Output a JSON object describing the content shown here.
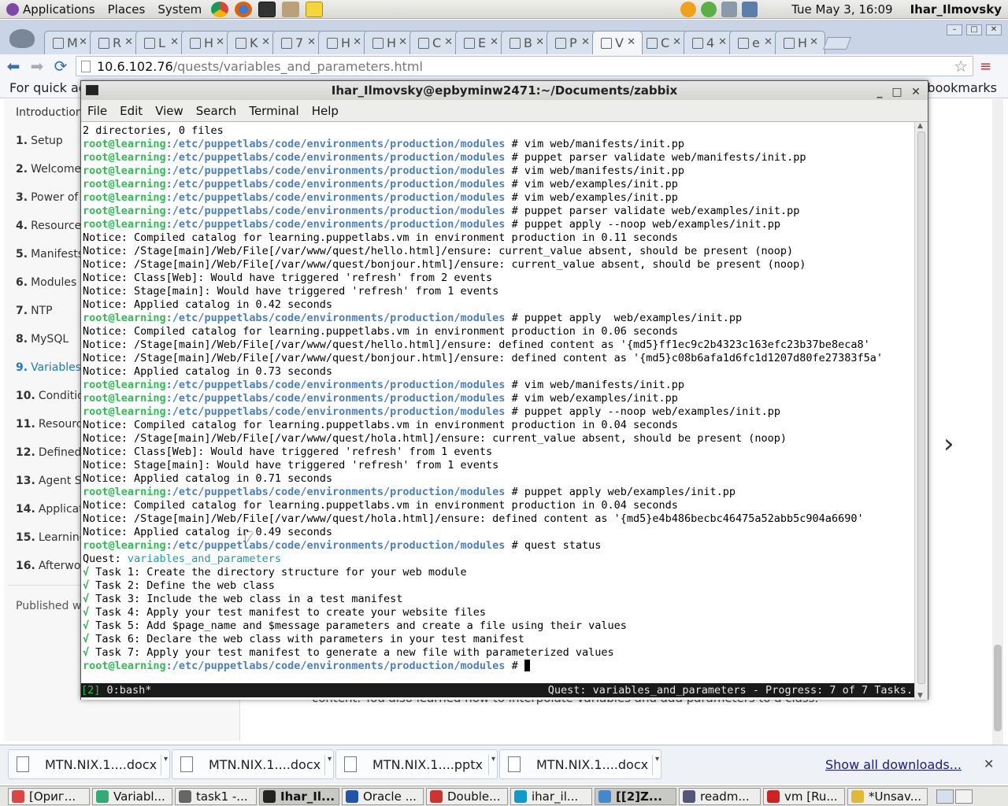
{
  "panel": {
    "menus": [
      "Applications",
      "Places",
      "System"
    ],
    "launchers": [
      "chrome-icon",
      "firefox-icon",
      "terminal-icon",
      "file-manager-icon",
      "notes-icon"
    ],
    "tray_icons": [
      "weather-icon",
      "chat-icon",
      "volume-icon",
      "network-icon"
    ],
    "clock": "Tue May  3, 16:09",
    "user": "Ihar_Ilmovsky"
  },
  "chrome": {
    "tabs": [
      {
        "label": "M"
      },
      {
        "label": "R"
      },
      {
        "label": "L"
      },
      {
        "label": "H"
      },
      {
        "label": "K"
      },
      {
        "label": "7"
      },
      {
        "label": "H"
      },
      {
        "label": "H"
      },
      {
        "label": "C"
      },
      {
        "label": "E"
      },
      {
        "label": "B"
      },
      {
        "label": "P"
      },
      {
        "label": "V",
        "active": true
      },
      {
        "label": "C"
      },
      {
        "label": "4"
      },
      {
        "label": "e"
      },
      {
        "label": "H"
      }
    ],
    "url_host": "10.6.102.76",
    "url_path": "/quests/variables_and_parameters.html",
    "bookmarks_hint": "For quick ac",
    "other_bookmarks": "bookmarks"
  },
  "sidebar": {
    "intro": "Introduction",
    "items": [
      {
        "num": "1.",
        "label": "Setup"
      },
      {
        "num": "2.",
        "label": "Welcome"
      },
      {
        "num": "3.",
        "label": "Power of P"
      },
      {
        "num": "4.",
        "label": "Resource"
      },
      {
        "num": "5.",
        "label": "Manifests"
      },
      {
        "num": "6.",
        "label": "Modules"
      },
      {
        "num": "7.",
        "label": "NTP"
      },
      {
        "num": "8.",
        "label": "MySQL"
      },
      {
        "num": "9.",
        "label": "Variables",
        "current": true
      },
      {
        "num": "10.",
        "label": "Condition"
      },
      {
        "num": "11.",
        "label": "Resourc"
      },
      {
        "num": "12.",
        "label": "Defined r"
      },
      {
        "num": "13.",
        "label": "Agent Se"
      },
      {
        "num": "14.",
        "label": "Applicati"
      },
      {
        "num": "15.",
        "label": "Learning"
      },
      {
        "num": "16.",
        "label": "Afterwor"
      }
    ],
    "published": "Published wi"
  },
  "page": {
    "partial_text": "content. You also learned how to interpolate variables and add parameters to a class."
  },
  "downloads": {
    "items": [
      {
        "name": "MTN.NIX.1....docx"
      },
      {
        "name": "MTN.NIX.1....docx"
      },
      {
        "name": "MTN.NIX.1....pptx"
      },
      {
        "name": "MTN.NIX.1....docx"
      }
    ],
    "show_all": "Show all downloads...",
    "close": "✕"
  },
  "taskbar": {
    "items": [
      {
        "label": "[Ориг...",
        "icon_color": "#d44"
      },
      {
        "label": "Variabl...",
        "icon_color": "#3a7"
      },
      {
        "label": "task1 -...",
        "icon_color": "#666"
      },
      {
        "label": "Ihar_Il...",
        "icon_color": "#222",
        "active": true
      },
      {
        "label": "Oracle ...",
        "icon_color": "#25a"
      },
      {
        "label": "Double...",
        "icon_color": "#c33"
      },
      {
        "label": "ihar_il...",
        "icon_color": "#19c"
      },
      {
        "label": "[[2]Z...",
        "icon_color": "#48c",
        "active": true
      },
      {
        "label": "readm...",
        "icon_color": "#557"
      },
      {
        "label": "vm [Ru...",
        "icon_color": "#c22"
      },
      {
        "label": "*Unsav...",
        "icon_color": "#db3"
      }
    ]
  },
  "terminal": {
    "title": "Ihar_Ilmovsky@epbyminw2471:~/Documents/zabbix",
    "menus": [
      "File",
      "Edit",
      "View",
      "Search",
      "Terminal",
      "Help"
    ],
    "prompt_user": "root@learning",
    "prompt_path": ":/etc/puppetlabs/code/environments/production/modules",
    "prompt_tail": " # ",
    "quest_label": "Quest: ",
    "quest_name": "variables_and_parameters",
    "check": "√",
    "lines": [
      {
        "t": "out",
        "text": "2 directories, 0 files"
      },
      {
        "t": "cmd",
        "text": "vim web/manifests/init.pp"
      },
      {
        "t": "cmd",
        "text": "puppet parser validate web/manifests/init.pp"
      },
      {
        "t": "cmd",
        "text": "vim web/manifests/init.pp"
      },
      {
        "t": "cmd",
        "text": "vim web/examples/init.pp"
      },
      {
        "t": "cmd",
        "text": "vim web/examples/init.pp"
      },
      {
        "t": "cmd",
        "text": "puppet parser validate web/examples/init.pp"
      },
      {
        "t": "cmd",
        "text": "puppet apply --noop web/examples/init.pp"
      },
      {
        "t": "out",
        "text": "Notice: Compiled catalog for learning.puppetlabs.vm in environment production in 0.11 seconds"
      },
      {
        "t": "out",
        "text": "Notice: /Stage[main]/Web/File[/var/www/quest/hello.html]/ensure: current_value absent, should be present (noop)"
      },
      {
        "t": "out",
        "text": "Notice: /Stage[main]/Web/File[/var/www/quest/bonjour.html]/ensure: current_value absent, should be present (noop)"
      },
      {
        "t": "out",
        "text": "Notice: Class[Web]: Would have triggered 'refresh' from 2 events"
      },
      {
        "t": "out",
        "text": "Notice: Stage[main]: Would have triggered 'refresh' from 1 events"
      },
      {
        "t": "out",
        "text": "Notice: Applied catalog in 0.42 seconds"
      },
      {
        "t": "cmd",
        "text": "puppet apply  web/examples/init.pp"
      },
      {
        "t": "out",
        "text": "Notice: Compiled catalog for learning.puppetlabs.vm in environment production in 0.06 seconds"
      },
      {
        "t": "out",
        "text": "Notice: /Stage[main]/Web/File[/var/www/quest/hello.html]/ensure: defined content as '{md5}ff1ec9c2b4323c163efc23b37be8eca8'"
      },
      {
        "t": "out",
        "text": "Notice: /Stage[main]/Web/File[/var/www/quest/bonjour.html]/ensure: defined content as '{md5}c08b6afa1d6fc1d1207d80fe27383f5a'"
      },
      {
        "t": "out",
        "text": "Notice: Applied catalog in 0.73 seconds"
      },
      {
        "t": "cmd",
        "text": "vim web/manifests/init.pp"
      },
      {
        "t": "cmd",
        "text": "vim web/examples/init.pp"
      },
      {
        "t": "cmd",
        "text": "puppet apply --noop web/examples/init.pp"
      },
      {
        "t": "out",
        "text": "Notice: Compiled catalog for learning.puppetlabs.vm in environment production in 0.04 seconds"
      },
      {
        "t": "out",
        "text": "Notice: /Stage[main]/Web/File[/var/www/quest/hola.html]/ensure: current_value absent, should be present (noop)"
      },
      {
        "t": "out",
        "text": "Notice: Class[Web]: Would have triggered 'refresh' from 1 events"
      },
      {
        "t": "out",
        "text": "Notice: Stage[main]: Would have triggered 'refresh' from 1 events"
      },
      {
        "t": "out",
        "text": "Notice: Applied catalog in 0.71 seconds"
      },
      {
        "t": "cmd",
        "text": "puppet apply web/examples/init.pp"
      },
      {
        "t": "out",
        "text": "Notice: Compiled catalog for learning.puppetlabs.vm in environment production in 0.04 seconds"
      },
      {
        "t": "out",
        "text": "Notice: /Stage[main]/Web/File[/var/www/quest/hola.html]/ensure: defined content as '{md5}e4b486becbc46475a52abb5c904a6690'"
      },
      {
        "t": "out",
        "text": "Notice: Applied catalog in 0.49 seconds"
      },
      {
        "t": "cmd",
        "text": "quest status"
      },
      {
        "t": "quest"
      },
      {
        "t": "task",
        "text": " Task 1: Create the directory structure for your web module"
      },
      {
        "t": "task",
        "text": " Task 2: Define the web class"
      },
      {
        "t": "task",
        "text": " Task 3: Include the web class in a test manifest"
      },
      {
        "t": "task",
        "text": " Task 4: Apply your test manifest to create your website files"
      },
      {
        "t": "task",
        "text": " Task 5: Add $page_name and $message parameters and create a file using their values"
      },
      {
        "t": "task",
        "text": " Task 6: Declare the web class with parameters in your test manifest"
      },
      {
        "t": "task",
        "text": " Task 7: Apply your test manifest to generate a new file with parameterized values"
      },
      {
        "t": "prompt"
      }
    ],
    "status_window": "[2]",
    "status_session": " 0:bash*",
    "status_right": "Quest: variables_and_parameters - Progress: 7 of 7 Tasks."
  }
}
